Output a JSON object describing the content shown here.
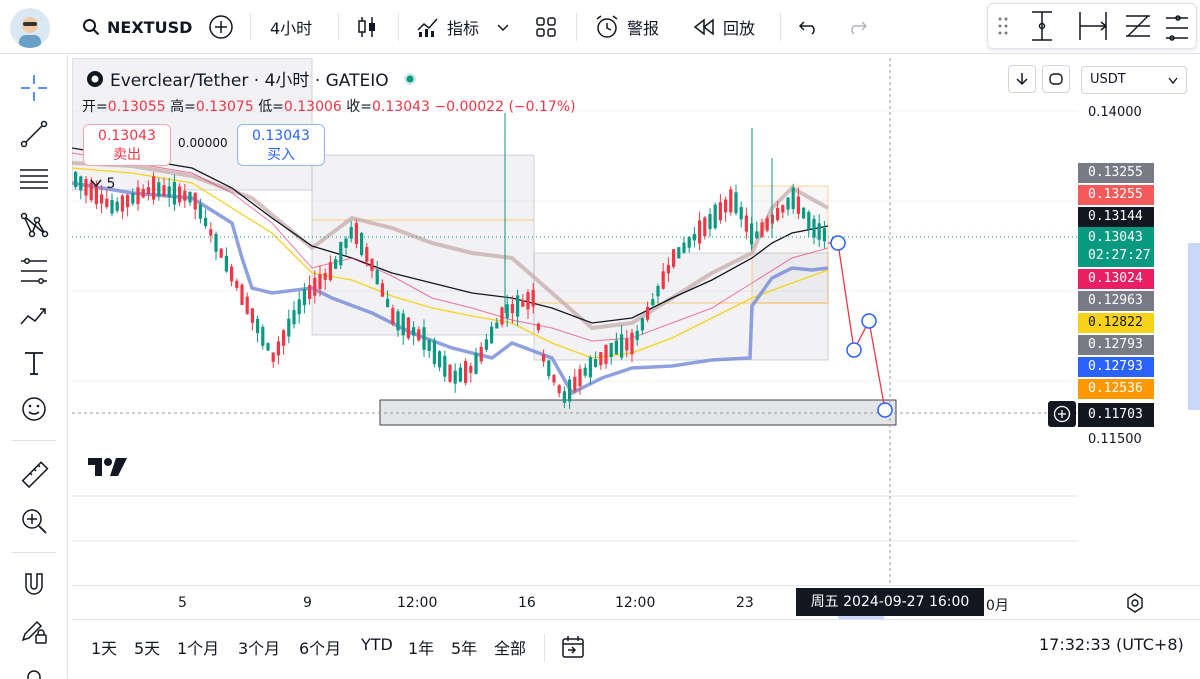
{
  "topbar": {
    "symbol": "NEXTUSD",
    "interval": "4小时",
    "indicators_label": "指标",
    "alerts_label": "警报",
    "replay_label": "回放"
  },
  "legend": {
    "title": "Everclear/Tether · 4小时 · GATEIO",
    "open_label": "开=",
    "open": "0.13055",
    "high_label": "高=",
    "high": "0.13075",
    "low_label": "低=",
    "low": "0.13006",
    "close_label": "收=",
    "close": "0.13043",
    "change": "−0.00022 (−0.17%)"
  },
  "trade": {
    "sell_price": "0.13043",
    "sell_label": "卖出",
    "spread": "0.00000",
    "buy_price": "0.13043",
    "buy_label": "买入",
    "indicator_count": "5"
  },
  "price_axis": {
    "currency": "USDT",
    "ticks": [
      "0.14000",
      "0.11500"
    ],
    "labels": [
      {
        "text": "0.13255",
        "color": "#787b86"
      },
      {
        "text": "0.13255",
        "color": "#f55a5a"
      },
      {
        "text": "0.13144",
        "color": "#131722"
      },
      {
        "text": "0.13043",
        "sub": "02:27:27",
        "color": "#089981"
      },
      {
        "text": "0.13024",
        "color": "#e91e63"
      },
      {
        "text": "0.12963",
        "color": "#787b86"
      },
      {
        "text": "0.12822",
        "color": "#f7d21b",
        "dark": true
      },
      {
        "text": "0.12793",
        "color": "#787b86"
      },
      {
        "text": "0.12793",
        "color": "#2962ff"
      },
      {
        "text": "0.12536",
        "color": "#ff9800"
      },
      {
        "text": "0.11703",
        "color": "#131722"
      }
    ]
  },
  "time_axis": {
    "labels": [
      "5",
      "9",
      "12:00",
      "16",
      "12:00",
      "23",
      "0月"
    ],
    "crosshair": "周五 2024-09-27   16:00"
  },
  "bottombar": {
    "ranges": [
      "1天",
      "5天",
      "1个月",
      "3个月",
      "6个月",
      "YTD",
      "1年",
      "5年",
      "全部"
    ],
    "clock": "17:32:33 (UTC+8)"
  },
  "colors": {
    "up": "#089981",
    "down": "#f23645",
    "accent": "#2962ff"
  }
}
